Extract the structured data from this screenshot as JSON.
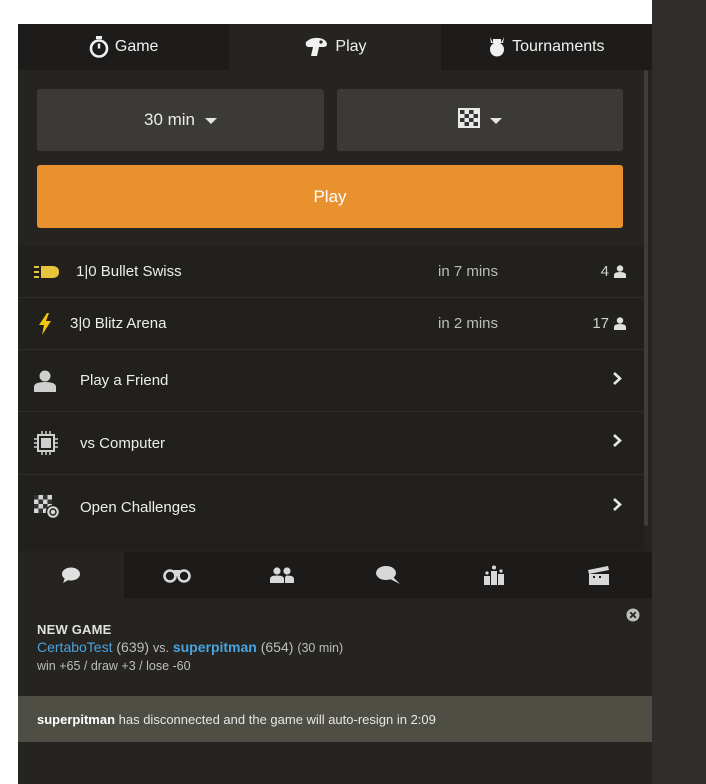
{
  "tabs": [
    {
      "label": "Game",
      "icon": "stopwatch-icon"
    },
    {
      "label": "Play",
      "icon": "pawn-icon"
    },
    {
      "label": "Tournaments",
      "icon": "trophy-icon"
    }
  ],
  "selectors": {
    "time": "30 min",
    "variant_icon": "checkerboard-icon"
  },
  "play_button": "Play",
  "events": [
    {
      "icon": "bullet-icon",
      "name": "1|0 Bullet Swiss",
      "when": "in 7 mins",
      "count": "4"
    },
    {
      "icon": "lightning-icon",
      "name": "3|0 Blitz Arena",
      "when": "in 2 mins",
      "count": "17"
    }
  ],
  "options": [
    {
      "icon": "person-icon",
      "label": "Play a Friend"
    },
    {
      "icon": "chip-icon",
      "label": "vs Computer"
    },
    {
      "icon": "challenge-icon",
      "label": "Open Challenges"
    }
  ],
  "chat_tabs": [
    "chat-bubble-icon",
    "binoculars-icon",
    "people-icon",
    "chat-dots-icon",
    "podium-icon",
    "clapperboard-icon"
  ],
  "new_game": {
    "title": "NEW GAME",
    "player1": "CertaboTest",
    "rating1": "(639)",
    "vs": "vs.",
    "player2": "superpitman",
    "rating2": "(654)",
    "time_control": "(30 min)",
    "odds": "win +65 / draw +3 / lose -60"
  },
  "notice": {
    "player": "superpitman",
    "message": " has disconnected and the game will auto-resign in 2:09"
  },
  "colors": {
    "accent": "#e8912e",
    "panel": "#262421",
    "link": "#4aa3df",
    "notice": "#4f4e44"
  }
}
